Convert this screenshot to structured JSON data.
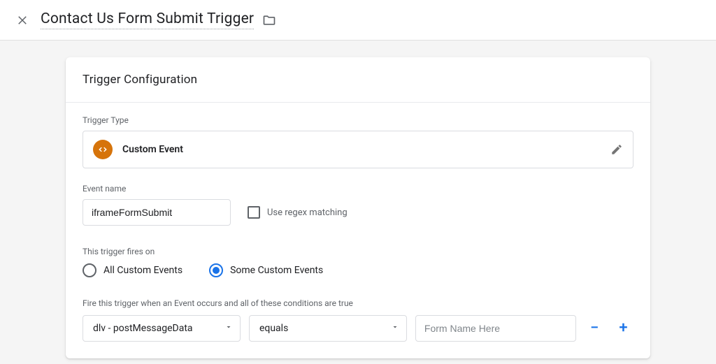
{
  "page_title": "Contact Us Form Submit Trigger",
  "card_title": "Trigger Configuration",
  "trigger_type": {
    "label": "Trigger Type",
    "value": "Custom Event",
    "icon_color": "#d6740b"
  },
  "event_name": {
    "label": "Event name",
    "value": "iframeFormSubmit",
    "regex_checkbox_label": "Use regex matching",
    "regex_checked": false
  },
  "fires_on": {
    "label": "This trigger fires on",
    "options": [
      "All Custom Events",
      "Some Custom Events"
    ],
    "selected_index": 1
  },
  "condition": {
    "label": "Fire this trigger when an Event occurs and all of these conditions are true",
    "rows": [
      {
        "variable": "dlv - postMessageData",
        "operator": "equals",
        "value_placeholder": "Form Name Here",
        "value": ""
      }
    ]
  }
}
